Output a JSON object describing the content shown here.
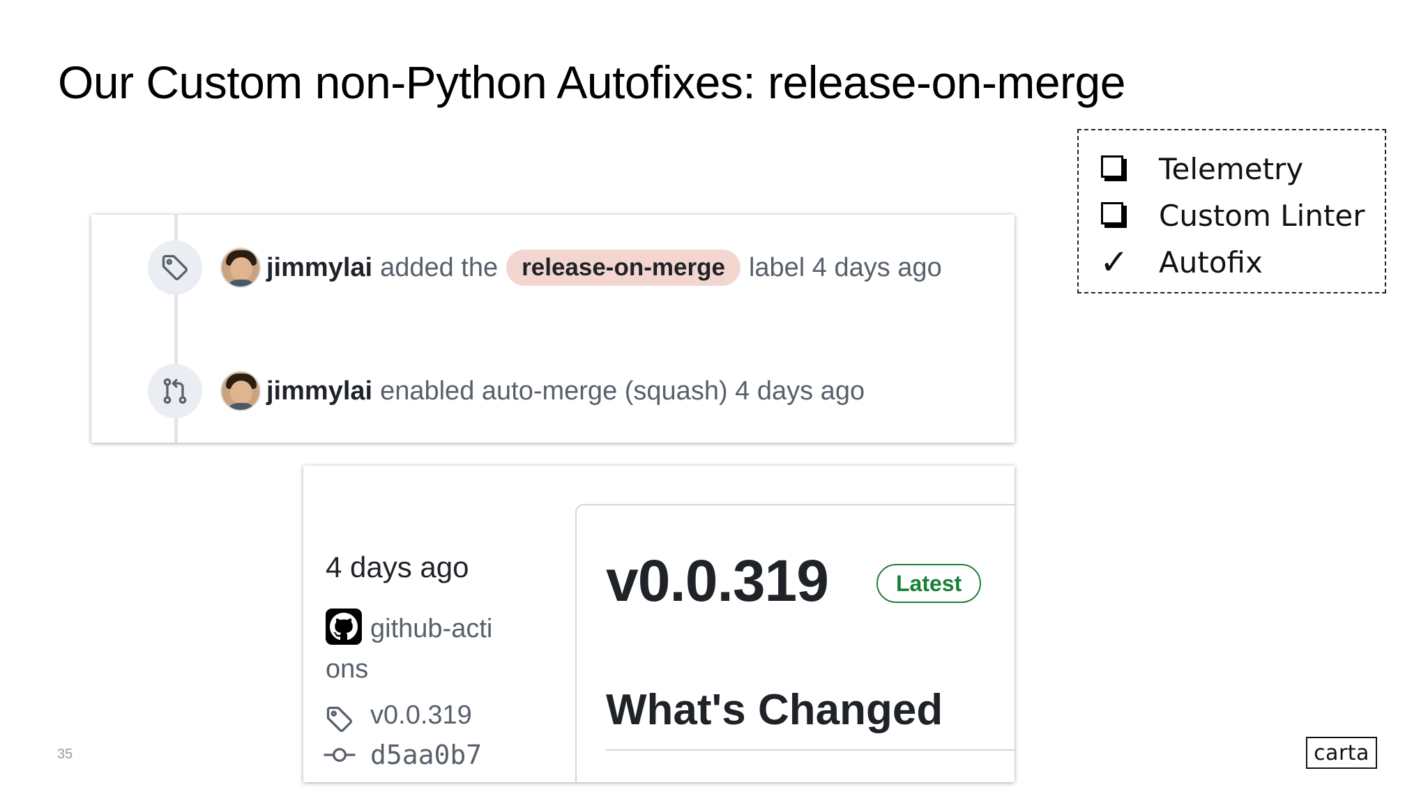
{
  "slide": {
    "title": "Our Custom non-Python Autofixes: release-on-merge",
    "page_number": "35",
    "logo_text": "carta"
  },
  "checklist": {
    "items": [
      {
        "label": "Telemetry",
        "state": "unchecked"
      },
      {
        "label": "Custom Linter",
        "state": "unchecked"
      },
      {
        "label": "Autofix",
        "state": "checked"
      }
    ],
    "check_glyph": "✓"
  },
  "timeline": {
    "events": [
      {
        "icon": "tag-icon",
        "user": "jimmylai",
        "action": "added the",
        "label": "release-on-merge",
        "suffix": "label 4 days ago"
      },
      {
        "icon": "git-pull-request-icon",
        "user": "jimmylai",
        "action": "enabled auto-merge (squash) 4 days ago"
      }
    ]
  },
  "release": {
    "date": "4 days ago",
    "author_line1": "github-acti",
    "author_line2": "ons",
    "tag": "v0.0.319",
    "commit": "d5aa0b7",
    "version": "v0.0.319",
    "badge": "Latest",
    "section_heading": "What's Changed"
  },
  "colors": {
    "label_bg": "#f3d6cf",
    "latest_green": "#1a7f37",
    "muted_text": "#57606a",
    "timeline_line": "#e1e4e8"
  }
}
